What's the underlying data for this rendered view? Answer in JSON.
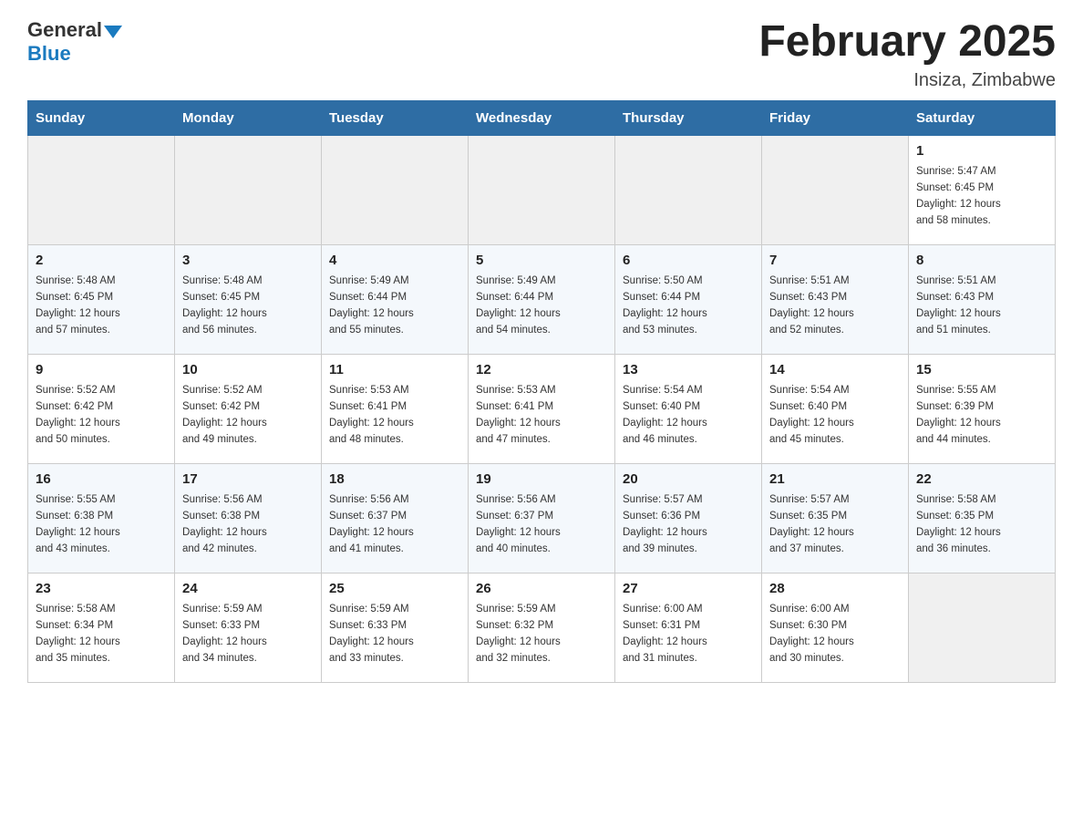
{
  "header": {
    "logo_general": "General",
    "logo_blue": "Blue",
    "month_title": "February 2025",
    "location": "Insiza, Zimbabwe"
  },
  "days_of_week": [
    "Sunday",
    "Monday",
    "Tuesday",
    "Wednesday",
    "Thursday",
    "Friday",
    "Saturday"
  ],
  "weeks": [
    [
      {
        "num": "",
        "info": ""
      },
      {
        "num": "",
        "info": ""
      },
      {
        "num": "",
        "info": ""
      },
      {
        "num": "",
        "info": ""
      },
      {
        "num": "",
        "info": ""
      },
      {
        "num": "",
        "info": ""
      },
      {
        "num": "1",
        "info": "Sunrise: 5:47 AM\nSunset: 6:45 PM\nDaylight: 12 hours\nand 58 minutes."
      }
    ],
    [
      {
        "num": "2",
        "info": "Sunrise: 5:48 AM\nSunset: 6:45 PM\nDaylight: 12 hours\nand 57 minutes."
      },
      {
        "num": "3",
        "info": "Sunrise: 5:48 AM\nSunset: 6:45 PM\nDaylight: 12 hours\nand 56 minutes."
      },
      {
        "num": "4",
        "info": "Sunrise: 5:49 AM\nSunset: 6:44 PM\nDaylight: 12 hours\nand 55 minutes."
      },
      {
        "num": "5",
        "info": "Sunrise: 5:49 AM\nSunset: 6:44 PM\nDaylight: 12 hours\nand 54 minutes."
      },
      {
        "num": "6",
        "info": "Sunrise: 5:50 AM\nSunset: 6:44 PM\nDaylight: 12 hours\nand 53 minutes."
      },
      {
        "num": "7",
        "info": "Sunrise: 5:51 AM\nSunset: 6:43 PM\nDaylight: 12 hours\nand 52 minutes."
      },
      {
        "num": "8",
        "info": "Sunrise: 5:51 AM\nSunset: 6:43 PM\nDaylight: 12 hours\nand 51 minutes."
      }
    ],
    [
      {
        "num": "9",
        "info": "Sunrise: 5:52 AM\nSunset: 6:42 PM\nDaylight: 12 hours\nand 50 minutes."
      },
      {
        "num": "10",
        "info": "Sunrise: 5:52 AM\nSunset: 6:42 PM\nDaylight: 12 hours\nand 49 minutes."
      },
      {
        "num": "11",
        "info": "Sunrise: 5:53 AM\nSunset: 6:41 PM\nDaylight: 12 hours\nand 48 minutes."
      },
      {
        "num": "12",
        "info": "Sunrise: 5:53 AM\nSunset: 6:41 PM\nDaylight: 12 hours\nand 47 minutes."
      },
      {
        "num": "13",
        "info": "Sunrise: 5:54 AM\nSunset: 6:40 PM\nDaylight: 12 hours\nand 46 minutes."
      },
      {
        "num": "14",
        "info": "Sunrise: 5:54 AM\nSunset: 6:40 PM\nDaylight: 12 hours\nand 45 minutes."
      },
      {
        "num": "15",
        "info": "Sunrise: 5:55 AM\nSunset: 6:39 PM\nDaylight: 12 hours\nand 44 minutes."
      }
    ],
    [
      {
        "num": "16",
        "info": "Sunrise: 5:55 AM\nSunset: 6:38 PM\nDaylight: 12 hours\nand 43 minutes."
      },
      {
        "num": "17",
        "info": "Sunrise: 5:56 AM\nSunset: 6:38 PM\nDaylight: 12 hours\nand 42 minutes."
      },
      {
        "num": "18",
        "info": "Sunrise: 5:56 AM\nSunset: 6:37 PM\nDaylight: 12 hours\nand 41 minutes."
      },
      {
        "num": "19",
        "info": "Sunrise: 5:56 AM\nSunset: 6:37 PM\nDaylight: 12 hours\nand 40 minutes."
      },
      {
        "num": "20",
        "info": "Sunrise: 5:57 AM\nSunset: 6:36 PM\nDaylight: 12 hours\nand 39 minutes."
      },
      {
        "num": "21",
        "info": "Sunrise: 5:57 AM\nSunset: 6:35 PM\nDaylight: 12 hours\nand 37 minutes."
      },
      {
        "num": "22",
        "info": "Sunrise: 5:58 AM\nSunset: 6:35 PM\nDaylight: 12 hours\nand 36 minutes."
      }
    ],
    [
      {
        "num": "23",
        "info": "Sunrise: 5:58 AM\nSunset: 6:34 PM\nDaylight: 12 hours\nand 35 minutes."
      },
      {
        "num": "24",
        "info": "Sunrise: 5:59 AM\nSunset: 6:33 PM\nDaylight: 12 hours\nand 34 minutes."
      },
      {
        "num": "25",
        "info": "Sunrise: 5:59 AM\nSunset: 6:33 PM\nDaylight: 12 hours\nand 33 minutes."
      },
      {
        "num": "26",
        "info": "Sunrise: 5:59 AM\nSunset: 6:32 PM\nDaylight: 12 hours\nand 32 minutes."
      },
      {
        "num": "27",
        "info": "Sunrise: 6:00 AM\nSunset: 6:31 PM\nDaylight: 12 hours\nand 31 minutes."
      },
      {
        "num": "28",
        "info": "Sunrise: 6:00 AM\nSunset: 6:30 PM\nDaylight: 12 hours\nand 30 minutes."
      },
      {
        "num": "",
        "info": ""
      }
    ]
  ]
}
